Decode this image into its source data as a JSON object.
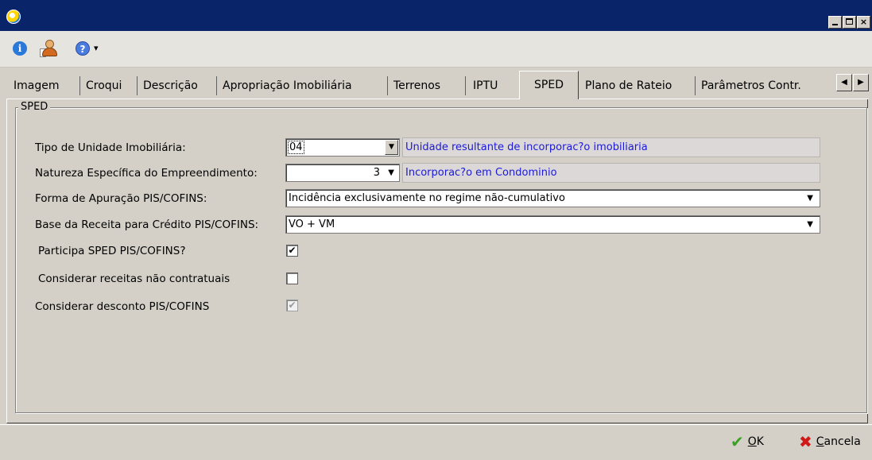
{
  "window": {
    "title": "",
    "minimize_glyph": "_",
    "maximize_glyph": "□",
    "close_glyph": "×"
  },
  "toolbar": {
    "info_glyph": "i",
    "help_glyph": "?",
    "dropdown_glyph": "▾"
  },
  "tabs": [
    {
      "label": "Imagem",
      "active": false
    },
    {
      "label": "Croqui",
      "active": false
    },
    {
      "label": "Descrição",
      "active": false
    },
    {
      "label": "Apropriação Imobiliária",
      "active": false
    },
    {
      "label": "Terrenos",
      "active": false
    },
    {
      "label": "IPTU",
      "active": false
    },
    {
      "label": "SPED",
      "active": true
    },
    {
      "label": "Plano de Rateio",
      "active": false
    },
    {
      "label": "Parâmetros Contr.",
      "active": false
    }
  ],
  "tab_scroll": {
    "left": "◀",
    "right": "▶"
  },
  "group": {
    "title": "SPED"
  },
  "form": {
    "tipo_unidade": {
      "label": "Tipo de Unidade Imobiliária:",
      "value": "04",
      "description": "Unidade resultante de incorporac?o imobiliaria"
    },
    "natureza": {
      "label": "Natureza Específica do Empreendimento:",
      "value": "3",
      "description": "Incorporac?o em Condominio"
    },
    "forma_apuracao": {
      "label": "Forma de Apuração PIS/COFINS:",
      "value": "Incidência exclusivamente no regime não-cumulativo"
    },
    "base_receita": {
      "label": "Base da Receita para Crédito PIS/COFINS:",
      "value": "VO + VM"
    },
    "participa_sped": {
      "label": "Participa SPED PIS/COFINS?",
      "checked": true,
      "mark": "✔"
    },
    "receitas_nao_contratuais": {
      "label": "Considerar receitas não contratuais",
      "checked": false,
      "mark": ""
    },
    "desconto": {
      "label": "Considerar desconto PIS/COFINS",
      "checked": true,
      "mark": "✔",
      "enabled": false
    }
  },
  "dropdown_arrow": "▼",
  "footer": {
    "ok_icon": "✔",
    "ok_label_underlined": "O",
    "ok_label_rest": "K",
    "cancel_icon": "✖",
    "cancel_label_underlined": "C",
    "cancel_label_rest": "ancela"
  }
}
